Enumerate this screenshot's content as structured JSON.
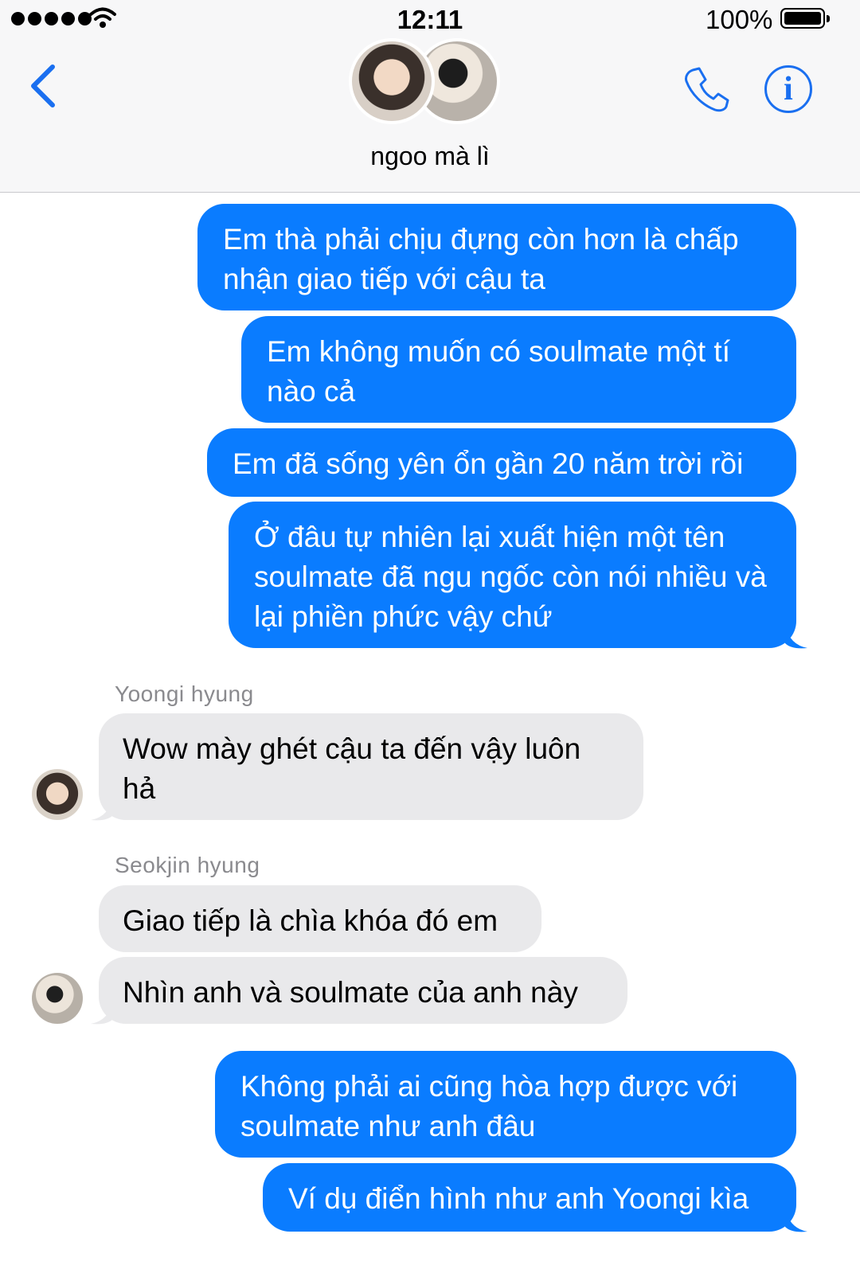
{
  "status_bar": {
    "time": "12:11",
    "battery_percent": "100%",
    "signal_dots": 5
  },
  "header": {
    "group_name": "ngoo mà lì",
    "back_icon": "chevron-left-icon",
    "call_icon": "phone-icon",
    "info_icon": "info-icon",
    "info_glyph": "i",
    "accent_color": "#1a6ff0"
  },
  "messages": {
    "out_1": "Em thà phải chịu đựng còn hơn là chấp nhận giao tiếp với cậu ta",
    "out_2": "Em không muốn có soulmate một tí nào cả",
    "out_3": "Em đã sống yên ổn gần 20 năm trời rồi",
    "out_4": "Ở đâu tự nhiên lại xuất hiện một tên soulmate đã ngu ngốc còn nói nhiều và lại phiền phức vậy chứ",
    "sender_1": "Yoongi hyung",
    "in_1": "Wow mày ghét cậu ta đến vậy luôn hả",
    "sender_2": "Seokjin hyung",
    "in_2": "Giao tiếp là chìa khóa đó em",
    "in_3": "Nhìn anh và soulmate của anh này",
    "out_5": "Không phải ai cũng hòa hợp được với soulmate như anh đâu",
    "out_6": "Ví dụ điển hình như anh Yoongi kìa"
  },
  "colors": {
    "outgoing_bubble": "#0a7cff",
    "incoming_bubble": "#e9e9eb",
    "sender_label": "#8a8a8e"
  }
}
